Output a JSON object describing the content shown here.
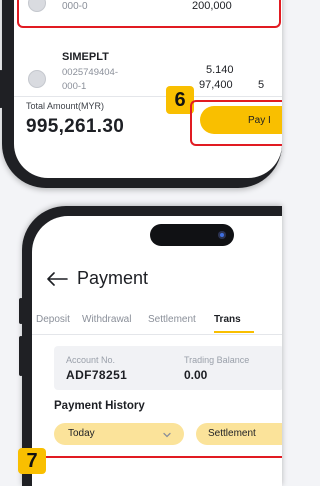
{
  "top_panel": {
    "prev_stock": {
      "code": "000-0",
      "value": "200,000"
    },
    "stock": {
      "name": "SIMEPLT",
      "code_line1": "0025749404-",
      "code_line2": "000-1",
      "price": "5.140",
      "amount": "97,400",
      "extra": "5"
    },
    "total_label": "Total Amount(MYR)",
    "total_value": "995,261.30",
    "pay_button": "Pay I",
    "step_badge": "6"
  },
  "bottom_panel": {
    "title": "Payment",
    "tabs": [
      "Deposit",
      "Withdrawal",
      "Settlement",
      "Trans"
    ],
    "active_tab_index": 3,
    "account_label": "Account No.",
    "account_value": "ADF78251",
    "balance_label": "Trading Balance",
    "balance_value": "0.00",
    "history_label": "Payment History",
    "filter_date": "Today",
    "filter_type": "Settlement",
    "step_badge": "7"
  },
  "colors": {
    "accent_yellow": "#f9bf00",
    "highlight_red": "#e11b22",
    "tab_underline": "#f9bf00"
  }
}
